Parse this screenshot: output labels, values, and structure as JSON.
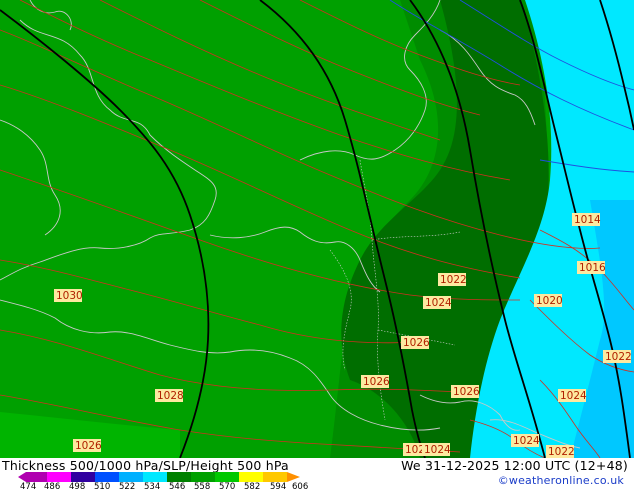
{
  "map": {
    "title": "Thickness 500/1000 hPa/SLP/Height 500 hPa",
    "valid_time": "We 31-12-2025 12:00 UTC (12+48)",
    "credit": "©weatheronline.co.uk",
    "isobar_labels": [
      "1014",
      "1016",
      "1020",
      "1022",
      "1022",
      "1022",
      "1022",
      "1024",
      "1024",
      "1024",
      "1024",
      "1026",
      "1026",
      "1026",
      "1026",
      "1028",
      "1030",
      "1016"
    ],
    "scale": {
      "ticks": [
        "474",
        "486",
        "498",
        "510",
        "522",
        "534",
        "546",
        "558",
        "570",
        "582",
        "594",
        "606"
      ],
      "colors": [
        "#b000b0",
        "#ff00ff",
        "#3000a0",
        "#0050ff",
        "#00b0ff",
        "#00e8ff",
        "#008000",
        "#00a000",
        "#00c800",
        "#ffff00",
        "#ffc800",
        "#ff9000"
      ]
    },
    "colors": {
      "thickness_546": "#00a000",
      "thickness_540": "#008c00",
      "thickness_534": "#006e00",
      "thickness_528": "#00e8ff",
      "thickness_522": "#00c8ff",
      "light_green": "#00b400",
      "isobar": "#d03020",
      "height_contour": "#000000",
      "coastline": "#c8c8c8"
    }
  }
}
